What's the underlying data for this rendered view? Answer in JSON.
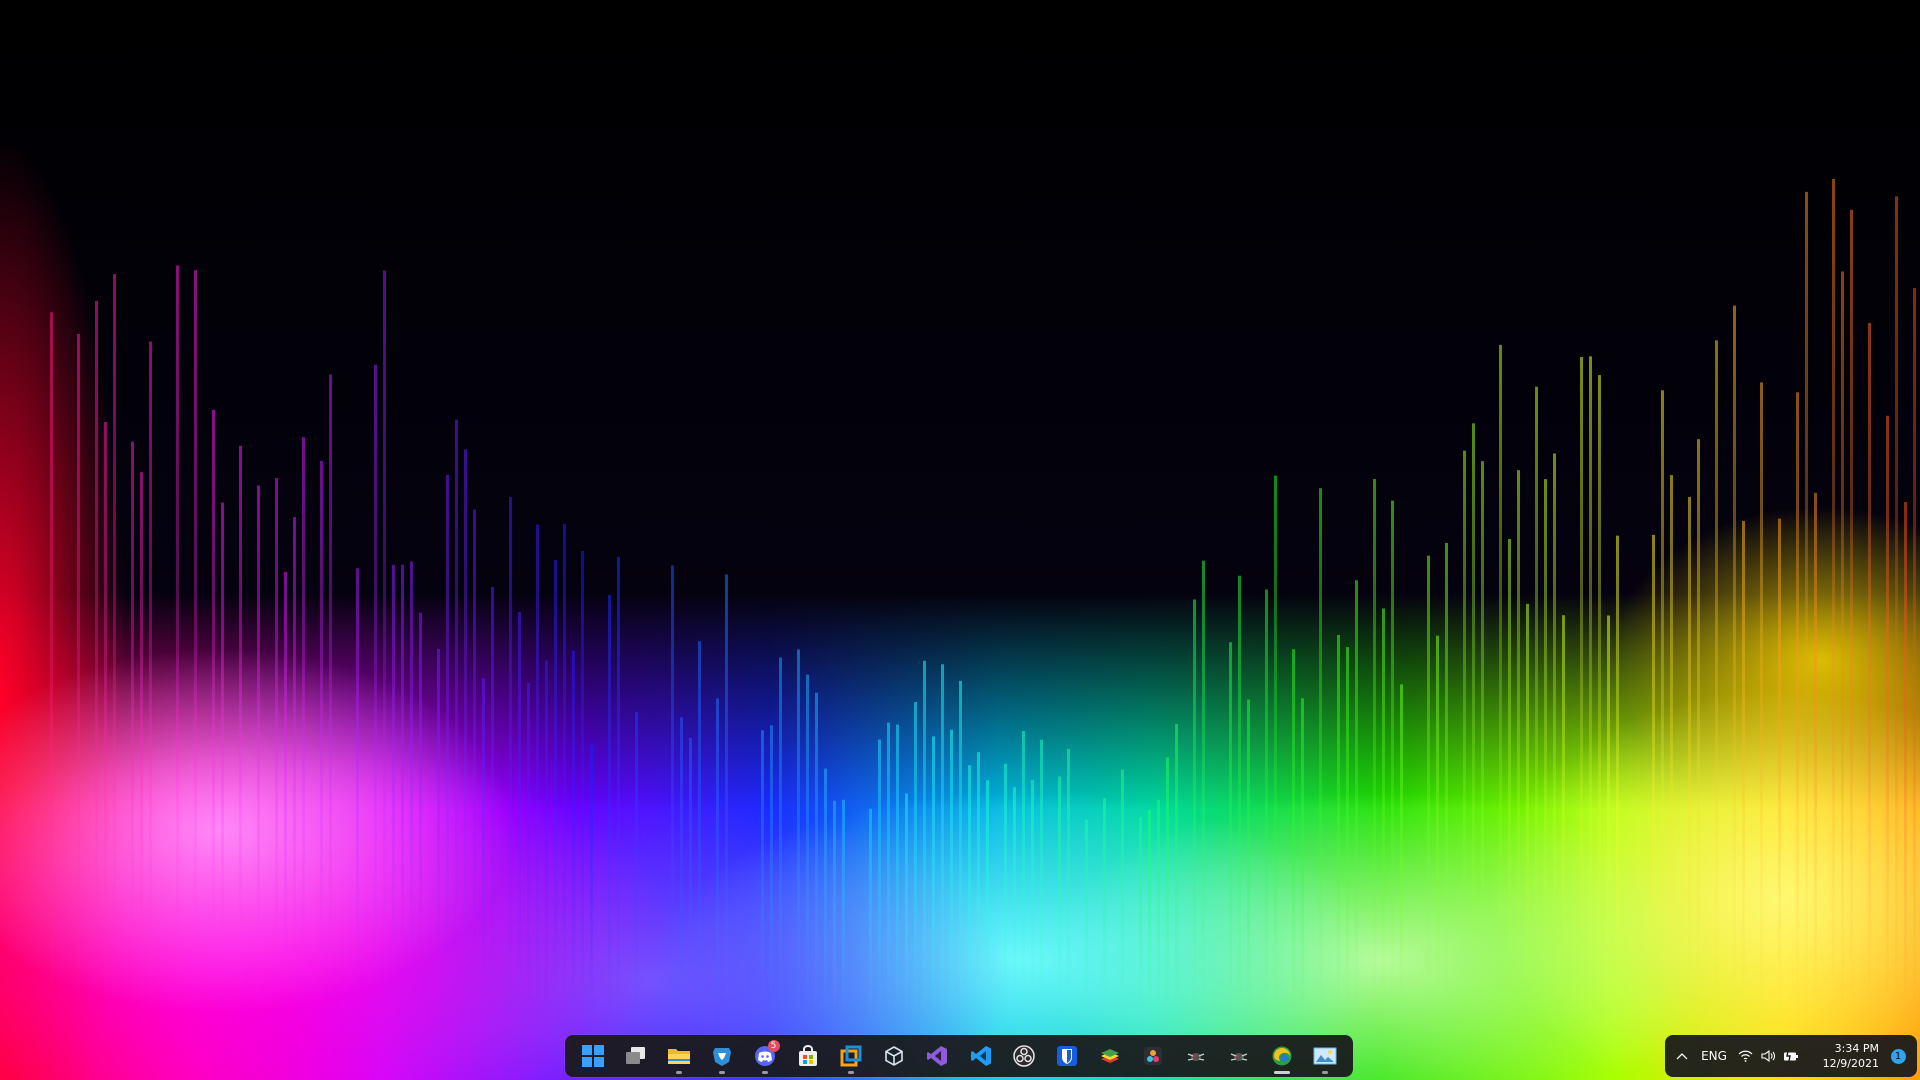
{
  "desktop": {
    "wallpaper": "rainbow-audio-spectrum-bars"
  },
  "taskbar": {
    "items": [
      {
        "name": "start-button",
        "icon": "windows-logo-icon",
        "running": false
      },
      {
        "name": "task-view-button",
        "icon": "task-view-icon",
        "running": false
      },
      {
        "name": "file-explorer-button",
        "icon": "folder-icon",
        "running": true
      },
      {
        "name": "brave-browser-button",
        "icon": "brave-lion-icon",
        "running": true
      },
      {
        "name": "discord-button",
        "icon": "discord-icon",
        "running": true,
        "badge": "5"
      },
      {
        "name": "microsoft-store-button",
        "icon": "store-bag-icon",
        "running": false
      },
      {
        "name": "virtualbox-button",
        "icon": "virtualbox-icon",
        "running": true
      },
      {
        "name": "3d-viewer-button",
        "icon": "cube-icon",
        "running": false
      },
      {
        "name": "visual-studio-button",
        "icon": "visual-studio-icon",
        "running": false
      },
      {
        "name": "vscode-button",
        "icon": "vscode-icon",
        "running": false
      },
      {
        "name": "obs-studio-button",
        "icon": "obs-icon",
        "running": false
      },
      {
        "name": "bitwarden-button",
        "icon": "bitwarden-shield-icon",
        "running": false
      },
      {
        "name": "bluestacks-button",
        "icon": "bluestacks-icon",
        "running": false
      },
      {
        "name": "davinci-resolve-button",
        "icon": "davinci-icon",
        "running": false
      },
      {
        "name": "app-bug-1-button",
        "icon": "bug-icon",
        "running": false
      },
      {
        "name": "app-bug-2-button",
        "icon": "bug-icon",
        "running": false
      },
      {
        "name": "edge-canary-button",
        "icon": "edge-icon",
        "running": true,
        "active": true
      },
      {
        "name": "image-viewer-button",
        "icon": "picture-icon",
        "running": true
      }
    ]
  },
  "tray": {
    "chevron_icon": "chevron-up-icon",
    "language": "ENG",
    "wifi_icon": "wifi-icon",
    "volume_icon": "speaker-icon",
    "battery_icon": "battery-charging-icon",
    "time": "3:34 PM",
    "date": "12/9/2021",
    "notification_count": "1"
  },
  "colors": {
    "taskbar_bg": "#19191c",
    "badge": "#e84a5f",
    "notification": "#2fa3ee"
  }
}
